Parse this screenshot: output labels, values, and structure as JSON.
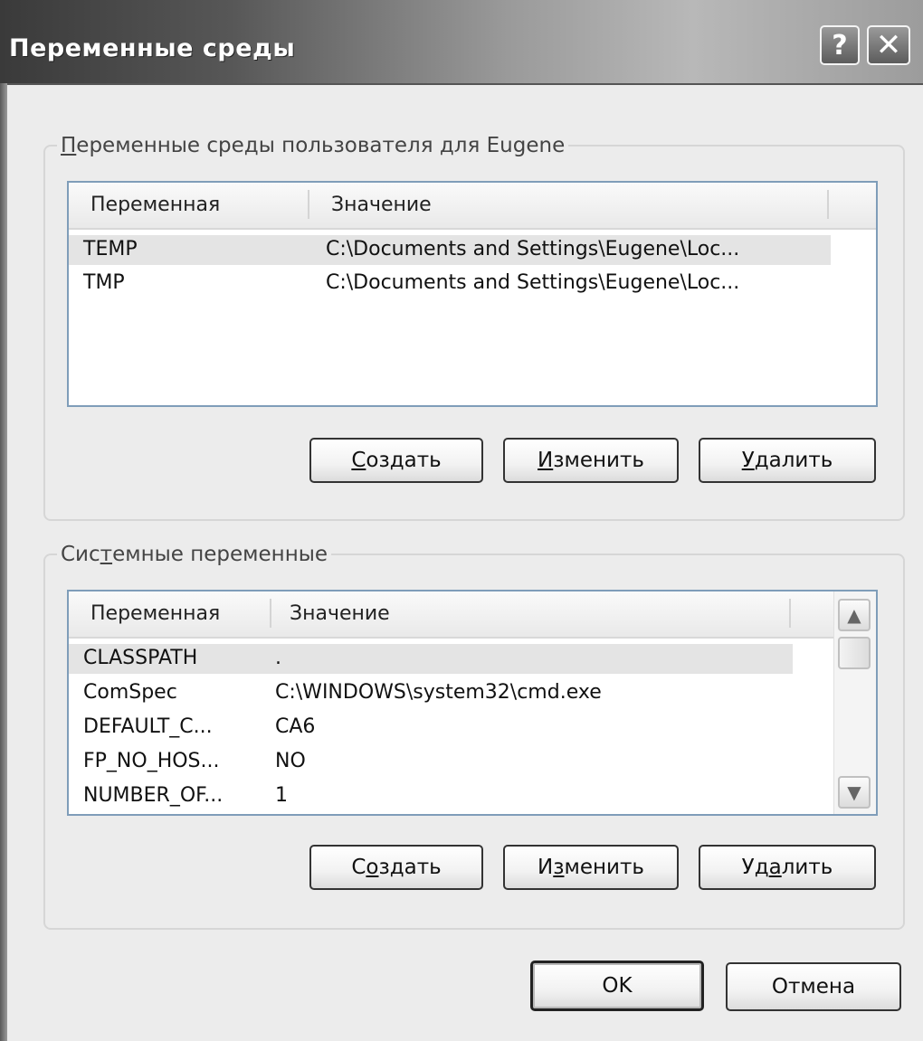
{
  "window": {
    "title": "Переменные среды",
    "help_glyph": "?",
    "close_glyph": "✕"
  },
  "user_group": {
    "label_prefix": "",
    "label_underlined": "П",
    "label_rest": "еременные среды пользователя для Eugene",
    "columns": [
      "Переменная",
      "Значение"
    ],
    "rows": [
      {
        "name": "TEMP",
        "value": "C:\\Documents and Settings\\Eugene\\Loc...",
        "selected": true
      },
      {
        "name": "TMP",
        "value": "C:\\Documents and Settings\\Eugene\\Loc...",
        "selected": false
      }
    ],
    "buttons": {
      "create": {
        "pre": "",
        "u": "С",
        "post": "оздать"
      },
      "edit": {
        "pre": "",
        "u": "И",
        "post": "зменить"
      },
      "delete": {
        "pre": "",
        "u": "У",
        "post": "далить"
      }
    }
  },
  "system_group": {
    "label_prefix": "Сис",
    "label_underlined": "т",
    "label_rest": "емные переменные",
    "columns": [
      "Переменная",
      "Значение"
    ],
    "rows": [
      {
        "name": "CLASSPATH",
        "value": ".",
        "selected": true
      },
      {
        "name": "ComSpec",
        "value": "C:\\WINDOWS\\system32\\cmd.exe",
        "selected": false
      },
      {
        "name": "DEFAULT_C...",
        "value": "CA6",
        "selected": false
      },
      {
        "name": "FP_NO_HOS...",
        "value": "NO",
        "selected": false
      },
      {
        "name": "NUMBER_OF...",
        "value": "1",
        "selected": false
      }
    ],
    "buttons": {
      "create": {
        "pre": "С",
        "u": "о",
        "post": "здать"
      },
      "edit": {
        "pre": "И",
        "u": "з",
        "post": "менить"
      },
      "delete": {
        "pre": "Уд",
        "u": "а",
        "post": "лить"
      }
    },
    "scroll_up_glyph": "▲",
    "scroll_down_glyph": "▼"
  },
  "footer": {
    "ok_label": "OK",
    "cancel_label": "Отмена"
  }
}
